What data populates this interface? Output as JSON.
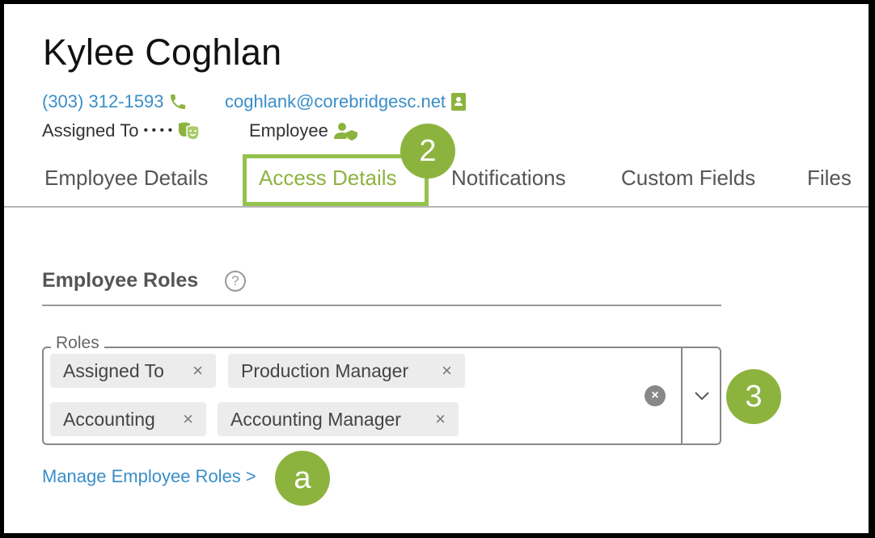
{
  "header": {
    "name": "Kylee Coghlan",
    "phone": "(303) 312-1593",
    "email": "coghlank@corebridgesc.net",
    "assigned_to_label": "Assigned To",
    "assigned_to_dots": "• • • •",
    "employee_label": "Employee"
  },
  "tabs": [
    {
      "label": "Employee Details",
      "active": false
    },
    {
      "label": "Access Details",
      "active": true
    },
    {
      "label": "Notifications",
      "active": false
    },
    {
      "label": "Custom Fields",
      "active": false
    },
    {
      "label": "Files",
      "active": false
    }
  ],
  "callouts": {
    "tab_badge": "2",
    "roles_badge": "3",
    "link_badge": "a"
  },
  "roles_section": {
    "title": "Employee Roles",
    "help_glyph": "?",
    "field_label": "Roles",
    "chips": [
      {
        "label": "Assigned To",
        "remove_glyph": "×"
      },
      {
        "label": "Production Manager",
        "remove_glyph": "×"
      },
      {
        "label": "Accounting",
        "remove_glyph": "×"
      },
      {
        "label": "Accounting Manager",
        "remove_glyph": "×"
      }
    ],
    "clear_glyph": "×"
  },
  "manage_link": "Manage Employee Roles >",
  "colors": {
    "accent_green": "#8db33f",
    "link_blue": "#3a8ec8",
    "icon_green": "#8db33f"
  },
  "icons": [
    "phone-icon",
    "contact-card-icon",
    "theater-masks-icon",
    "user-shield-icon",
    "help-icon",
    "clear-icon",
    "chevron-down-icon"
  ]
}
